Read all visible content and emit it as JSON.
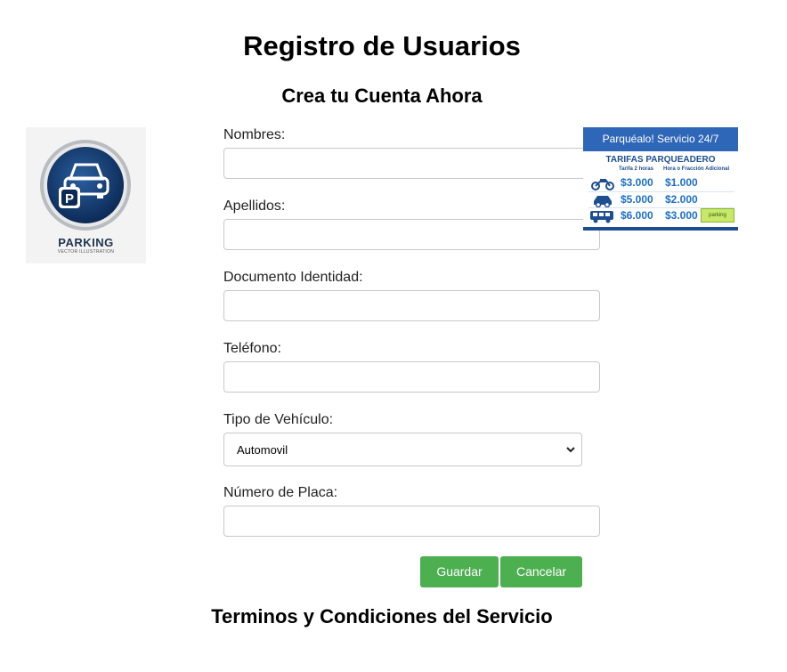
{
  "page": {
    "title": "Registro de Usuarios",
    "subtitle": "Crea tu Cuenta Ahora",
    "footer_heading": "Terminos y Condiciones del Servicio"
  },
  "logo": {
    "text": "PARKING",
    "subtext": "VECTOR ILLUSTRATION",
    "icon": "car-parking-icon"
  },
  "form": {
    "fields": {
      "nombres": {
        "label": "Nombres:",
        "value": ""
      },
      "apellidos": {
        "label": "Apellidos:",
        "value": ""
      },
      "documento": {
        "label": "Documento Identidad:",
        "value": ""
      },
      "telefono": {
        "label": "Teléfono:",
        "value": ""
      },
      "tipo_vehiculo": {
        "label": "Tipo de Vehículo:",
        "selected": "Automovil"
      },
      "placa": {
        "label": "Número de Placa:",
        "value": ""
      }
    },
    "buttons": {
      "save": "Guardar",
      "cancel": "Cancelar"
    }
  },
  "tarifas": {
    "header": "Parquéalo! Servicio 24/7",
    "title": "TARIFAS PARQUEADERO",
    "col1": "Tarifa 2 horas",
    "col2": "Hora o Fracción Adicional",
    "rows": [
      {
        "vehicle_icon": "motorcycle-icon",
        "tarifa": "$3.000",
        "adicional": "$1.000"
      },
      {
        "vehicle_icon": "car-icon",
        "tarifa": "$5.000",
        "adicional": "$2.000"
      },
      {
        "vehicle_icon": "bus-icon",
        "tarifa": "$6.000",
        "adicional": "$3.000"
      }
    ],
    "badge": "parking"
  },
  "colors": {
    "button_green": "#4caf50",
    "banner_blue": "#2f67b8",
    "price_blue": "#1d6fc7"
  }
}
